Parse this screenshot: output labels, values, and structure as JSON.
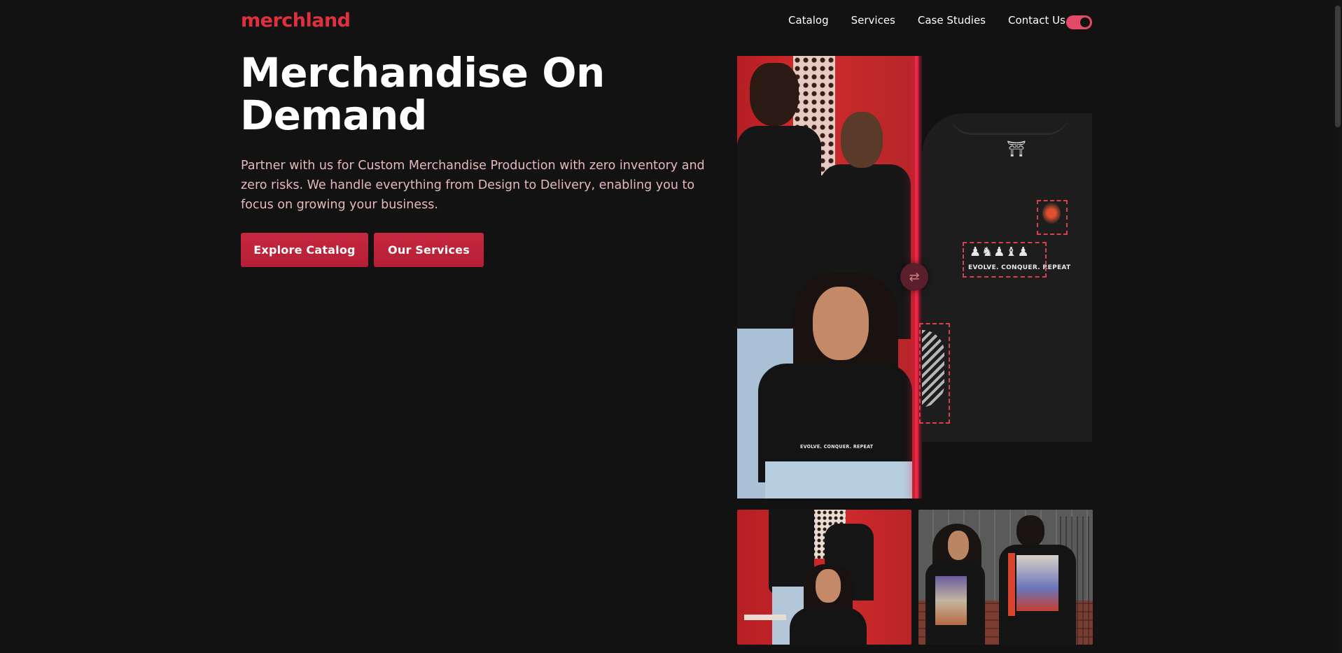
{
  "header": {
    "logo": "merchland",
    "nav": [
      "Catalog",
      "Services",
      "Case Studies",
      "Contact Us"
    ],
    "theme_toggle": {
      "state": "on",
      "color": "#e24a66"
    }
  },
  "hero": {
    "title": "Merchandise On Demand",
    "description": "Partner with us for Custom Merchandise Production with zero inventory and zero risks. We handle everything from Design to Delivery, enabling you to focus on growing your business.",
    "primary_button": "Explore Catalog",
    "secondary_button": "Our Services"
  },
  "showcase": {
    "shirt_slogan": "EVOLVE. CONQUER. REPEAT",
    "compare_handle_icon": "swap-arrows-icon",
    "thumbnails": [
      "group-photo-red-wall",
      "couple-photo-steps"
    ]
  },
  "colors": {
    "background": "#121212",
    "accent": "#e0303e",
    "button": "#c8283f",
    "description_text": "#e7b8bd"
  }
}
